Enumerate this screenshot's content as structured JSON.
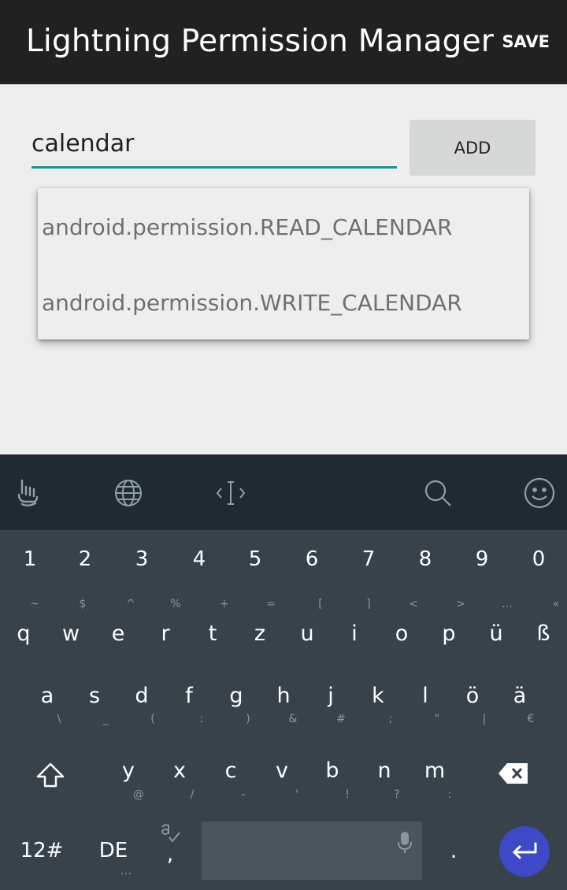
{
  "appbar": {
    "title": "Lightning Permission Manager",
    "save_label": "SAVE"
  },
  "permission_input": {
    "value": "calendar"
  },
  "add_button": {
    "label": "ADD"
  },
  "suggestions": [
    "android.permission.READ_CALENDAR",
    "android.permission.WRITE_CALENDAR"
  ],
  "accent_color": "#16968a",
  "keyboard": {
    "toolbar_icons": [
      "gesture-hand-icon",
      "globe-icon",
      "cursor-move-icon",
      "search-icon",
      "emoji-icon"
    ],
    "number_row": [
      "1",
      "2",
      "3",
      "4",
      "5",
      "6",
      "7",
      "8",
      "9",
      "0"
    ],
    "row1": {
      "keys": [
        "q",
        "w",
        "e",
        "r",
        "t",
        "z",
        "u",
        "i",
        "o",
        "p",
        "ü",
        "ß"
      ],
      "subs": [
        "~",
        "$",
        "^",
        "%",
        "+",
        "=",
        "[",
        "]",
        "<",
        ">",
        "…",
        "«"
      ]
    },
    "row2": {
      "keys": [
        "a",
        "s",
        "d",
        "f",
        "g",
        "h",
        "j",
        "k",
        "l",
        "ö",
        "ä"
      ],
      "subs": [
        "\\",
        "_",
        "(",
        ":",
        ")",
        "&",
        "#",
        ";",
        "\"",
        "|",
        "€"
      ]
    },
    "row3": {
      "keys": [
        "y",
        "x",
        "c",
        "v",
        "b",
        "n",
        "m"
      ],
      "subs": [
        "@",
        "/",
        "-",
        "'",
        "!",
        "?",
        ":"
      ]
    },
    "bottom": {
      "symbols": "12#",
      "language": "DE",
      "comma": ",",
      "comma_more": "…",
      "period": "."
    },
    "enter_color": "#3d49c7"
  }
}
